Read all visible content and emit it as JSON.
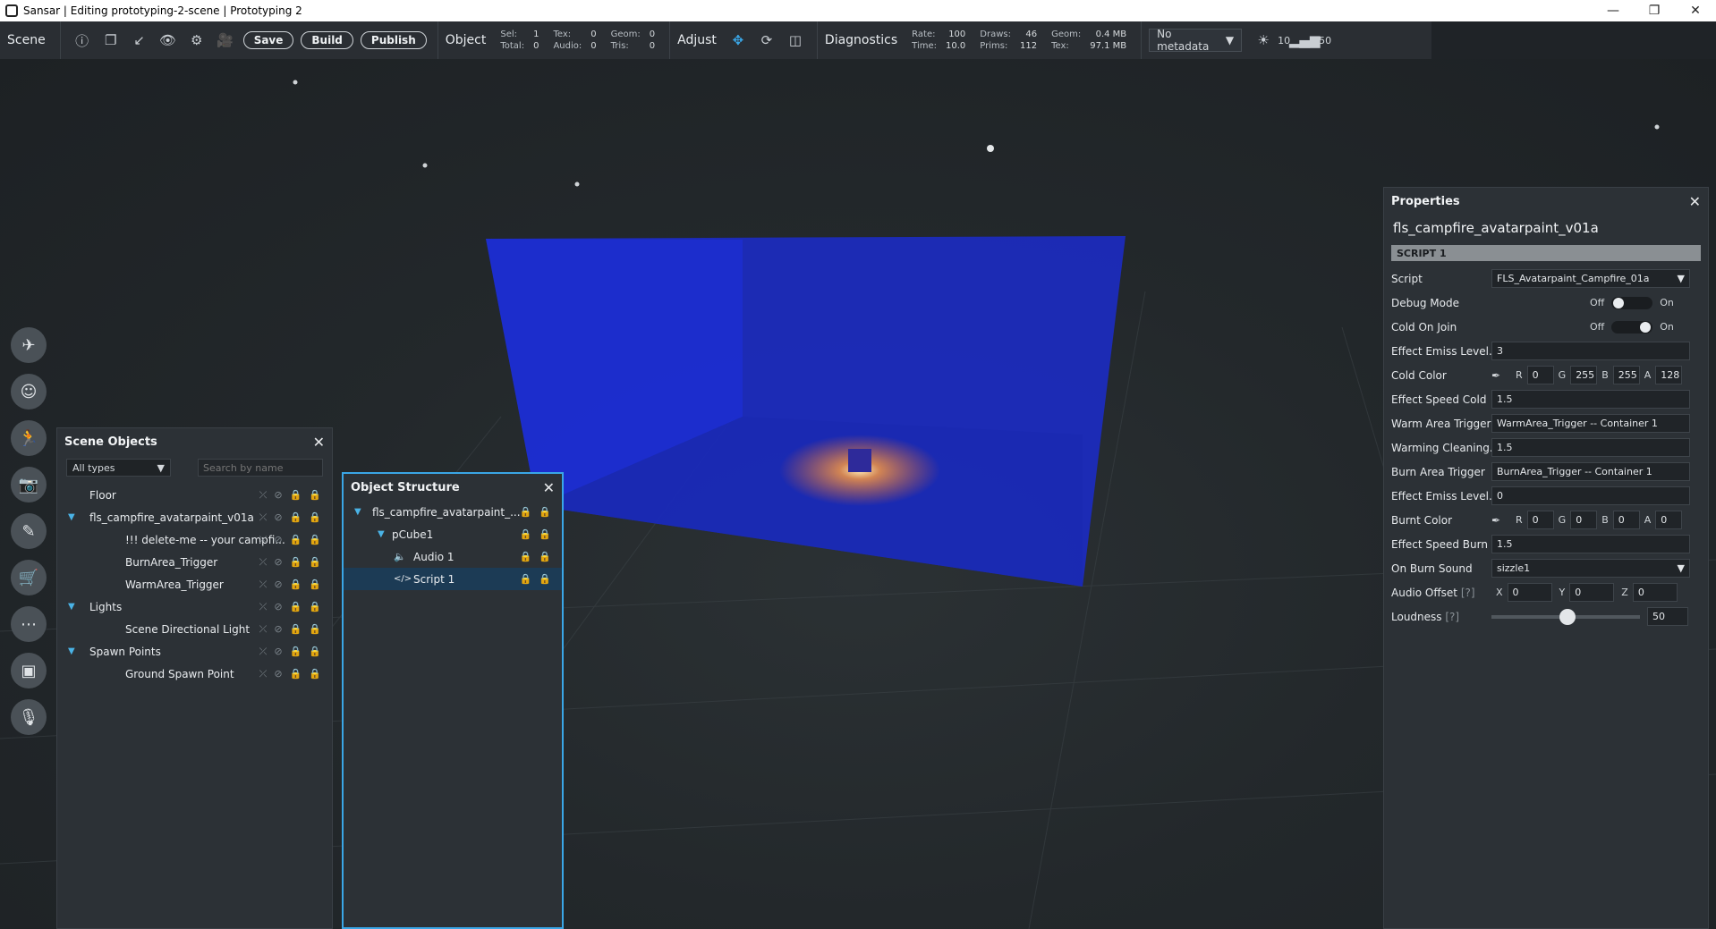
{
  "window": {
    "title": "Sansar | Editing prototyping-2-scene | Prototyping 2",
    "min": "—",
    "max": "❐",
    "close": "✕"
  },
  "toolbar": {
    "scene_label": "Scene",
    "save_label": "Save",
    "build_label": "Build",
    "publish_label": "Publish",
    "object_label": "Object",
    "sel_label": "Sel:",
    "sel_value": "1",
    "total_label": "Total:",
    "total_value": "0",
    "tex_label": "Tex:",
    "tex_value": "0",
    "audio_label": "Audio:",
    "audio_value": "0",
    "geom_label": "Geom:",
    "geom_value": "0",
    "tris_label": "Tris:",
    "tris_value": "0",
    "adjust_label": "Adjust",
    "diagnostics_label": "Diagnostics",
    "rate_label": "Rate:",
    "rate_value": "100",
    "time_label": "Time:",
    "time_value": "10.0",
    "draws_label": "Draws:",
    "draws_value": "46",
    "prims_label": "Prims:",
    "prims_value": "112",
    "dgeom_label": "Geom:",
    "dgeom_value": "0.4 MB",
    "dtex_label": "Tex:",
    "dtex_value": "97.1 MB",
    "metadata_select": "No metadata",
    "light_value": "10",
    "signal_value": "50"
  },
  "scene_objects": {
    "title": "Scene Objects",
    "filter": "All types",
    "search_placeholder": "Search by name",
    "items": [
      {
        "label": "Floor",
        "indent": 0,
        "arrow": ""
      },
      {
        "label": "fls_campfire_avatarpaint_v01a",
        "indent": 0,
        "arrow": "▼"
      },
      {
        "label": "!!! delete-me -- your campfi...",
        "indent": 1,
        "arrow": ""
      },
      {
        "label": "BurnArea_Trigger",
        "indent": 1,
        "arrow": ""
      },
      {
        "label": "WarmArea_Trigger",
        "indent": 1,
        "arrow": ""
      },
      {
        "label": "Lights",
        "indent": 0,
        "arrow": "▼"
      },
      {
        "label": "Scene Directional Light",
        "indent": 1,
        "arrow": ""
      },
      {
        "label": "Spawn Points",
        "indent": 0,
        "arrow": "▼"
      },
      {
        "label": "Ground Spawn Point",
        "indent": 1,
        "arrow": ""
      }
    ]
  },
  "object_structure": {
    "title": "Object Structure",
    "items": [
      {
        "label": "fls_campfire_avatarpaint_...",
        "arrow": "▼"
      },
      {
        "label": "pCube1",
        "arrow": "▼"
      },
      {
        "label": "Audio 1",
        "icon": "🔈"
      },
      {
        "label": "Script 1",
        "icon": "</>"
      }
    ]
  },
  "properties": {
    "title": "Properties",
    "object_name": "fls_campfire_avatarpaint_v01a",
    "section": "SCRIPT 1",
    "script_label": "Script",
    "script_value": "FLS_Avatarpaint_Campfire_01a",
    "debug_label": "Debug Mode",
    "cold_join_label": "Cold On Join",
    "off": "Off",
    "on": "On",
    "emiss_label": "Effect Emiss Level...",
    "emiss_value": "3",
    "cold_color_label": "Cold Color",
    "cold_r": "0",
    "cold_g": "255",
    "cold_b": "255",
    "cold_a": "128",
    "speed_cold_label": "Effect Speed Cold",
    "speed_cold_value": "1.5",
    "warm_trigger_label": "Warm Area Trigger",
    "warm_trigger_value": "WarmArea_Trigger -- Container 1",
    "warming_label": "Warming Cleaning...",
    "warming_value": "1.5",
    "burn_trigger_label": "Burn Area Trigger",
    "burn_trigger_value": "BurnArea_Trigger -- Container 1",
    "emiss2_label": "Effect Emiss Level...",
    "emiss2_value": "0",
    "burnt_color_label": "Burnt Color",
    "burnt_r": "0",
    "burnt_g": "0",
    "burnt_b": "0",
    "burnt_a": "0",
    "speed_burn_label": "Effect Speed Burn",
    "speed_burn_value": "1.5",
    "burn_sound_label": "On Burn Sound",
    "burn_sound_value": "sizzle1",
    "audio_offset_label": "Audio Offset",
    "help": "[?]",
    "x": "0",
    "y": "0",
    "z": "0",
    "loudness_label": "Loudness",
    "loudness_value": "50",
    "r": "R",
    "g": "G",
    "b": "B",
    "a": "A",
    "xl": "X",
    "yl": "Y",
    "zl": "Z"
  }
}
